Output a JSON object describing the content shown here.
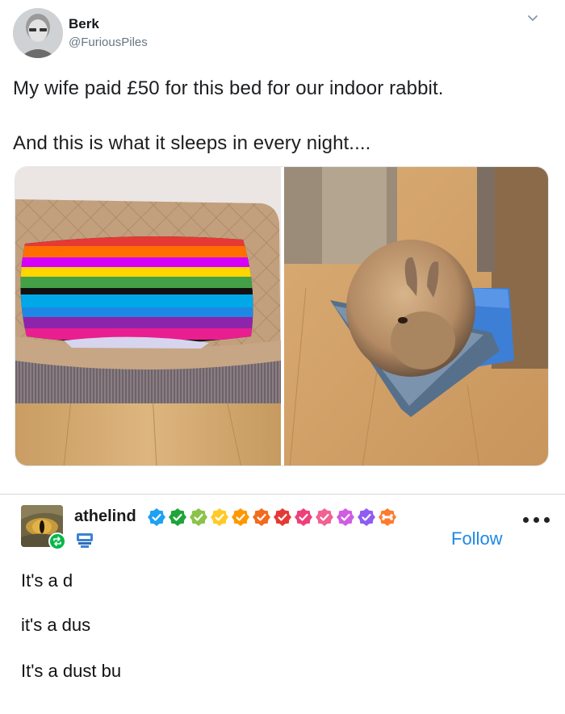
{
  "tweet": {
    "display_name": "Berk",
    "handle": "@FuriousPiles",
    "text_line_1": "My wife paid £50 for this bed for our indoor rabbit.",
    "text_line_2": "And this is what it sleeps in every night....",
    "menu_icon": "chevron-down-icon",
    "media": [
      "striped-blanket-pet-bed-photo",
      "rabbit-in-dustpan-photo"
    ]
  },
  "reblog": {
    "username": "athelind",
    "badges": [
      {
        "color": "#1da1f2",
        "icon": "check"
      },
      {
        "color": "#20a33a",
        "icon": "check"
      },
      {
        "color": "#8bc34a",
        "icon": "check"
      },
      {
        "color": "#ffca28",
        "icon": "check"
      },
      {
        "color": "#ff9800",
        "icon": "check"
      },
      {
        "color": "#f26b1d",
        "icon": "check"
      },
      {
        "color": "#e53935",
        "icon": "check"
      },
      {
        "color": "#ec407a",
        "icon": "check"
      },
      {
        "color": "#f06292",
        "icon": "check"
      },
      {
        "color": "#d05ce3",
        "icon": "check"
      },
      {
        "color": "#8e5cf2",
        "icon": "check"
      },
      {
        "color": "#ff7a2e",
        "icon": "bone"
      }
    ],
    "follow_label": "Follow",
    "follow_color": "#1e88e5",
    "reblog_icon": "reblog-icon",
    "more_icon": "more-horizontal-icon",
    "body_lines": [
      "It's a d",
      "it's a dus",
      "It's a dust bu"
    ]
  }
}
